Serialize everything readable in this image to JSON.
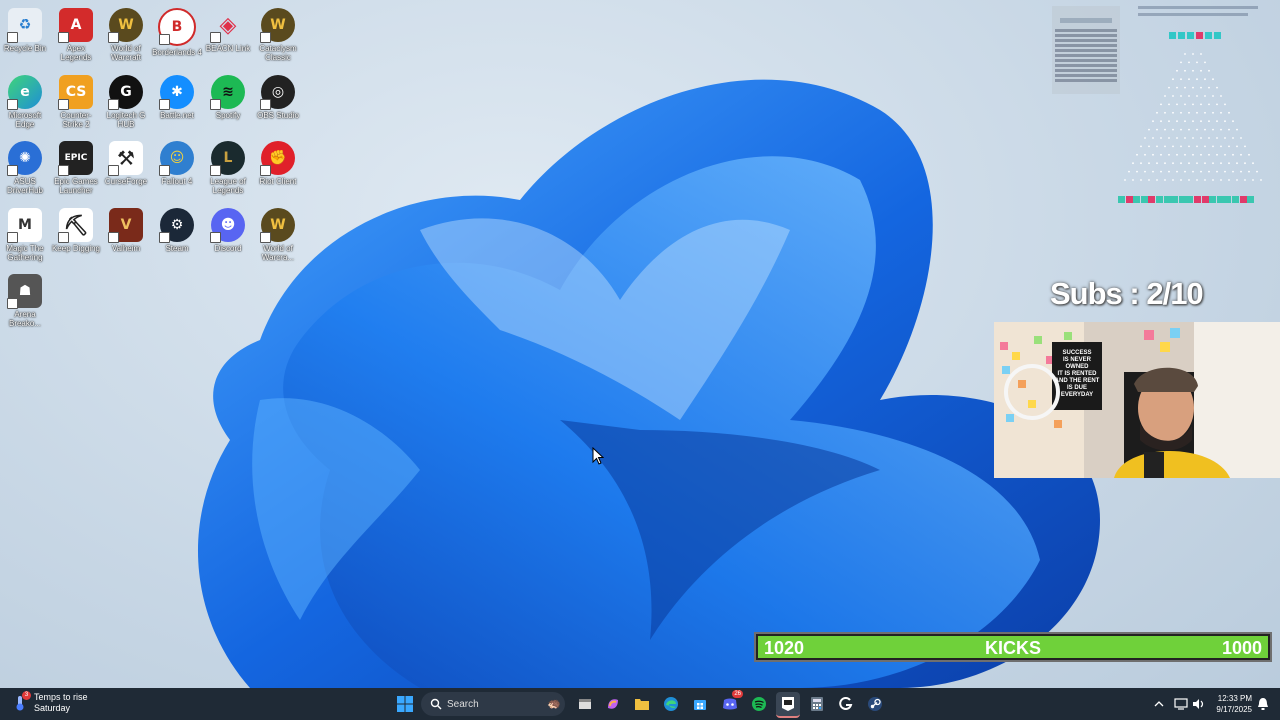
{
  "desktop_icons": [
    {
      "label": "Recycle Bin",
      "icon": "recycle-bin-icon",
      "color": "#ffffff"
    },
    {
      "label": "Apex Legends",
      "icon": "apex-legends-icon",
      "color": "#d32b2b"
    },
    {
      "label": "World of Warcraft",
      "icon": "world-of-warcraft-icon",
      "color": "#5a4a1e"
    },
    {
      "label": "Borderlands 4",
      "icon": "borderlands-icon",
      "color": "#ffffff"
    },
    {
      "label": "BEACN Link",
      "icon": "beacn-icon",
      "color": "#ffffff"
    },
    {
      "label": "Cataclysm Classic",
      "icon": "cataclysm-icon",
      "color": "#5a4a1e"
    },
    {
      "label": "Microsoft Edge",
      "icon": "edge-icon",
      "color": "#1f8fd6"
    },
    {
      "label": "Counter-Strike 2",
      "icon": "counter-strike-icon",
      "color": "#f0a020"
    },
    {
      "label": "Logitech G HUB",
      "icon": "logitech-icon",
      "color": "#111111"
    },
    {
      "label": "Battle.net",
      "icon": "battlenet-icon",
      "color": "#148eff"
    },
    {
      "label": "Spotify",
      "icon": "spotify-icon",
      "color": "#1db954"
    },
    {
      "label": "OBS Studio",
      "icon": "obs-icon",
      "color": "#222222"
    },
    {
      "label": "ASUS DriverHub",
      "icon": "asus-icon",
      "color": "#2a6fd6"
    },
    {
      "label": "Epic Games Launcher",
      "icon": "epic-games-icon",
      "color": "#222222"
    },
    {
      "label": "CurseForge",
      "icon": "curseforge-icon",
      "color": "#ffffff"
    },
    {
      "label": "Fallout 4",
      "icon": "fallout-icon",
      "color": "#2f7fd0"
    },
    {
      "label": "League of Legends",
      "icon": "league-icon",
      "color": "#1a2a2e"
    },
    {
      "label": "Riot Client",
      "icon": "riot-icon",
      "color": "#e0202a"
    },
    {
      "label": "Magic The Gathering",
      "icon": "magic-icon",
      "color": "#ffffff"
    },
    {
      "label": "Keep Digging",
      "icon": "pickaxe-icon",
      "color": "#ffffff"
    },
    {
      "label": "Valheim",
      "icon": "valheim-icon",
      "color": "#7a2a1a"
    },
    {
      "label": "Steam",
      "icon": "steam-icon",
      "color": "#1b2838"
    },
    {
      "label": "Discord",
      "icon": "discord-icon",
      "color": "#5865f2"
    },
    {
      "label": "World of Warcra...",
      "icon": "world-of-warcraft-icon",
      "color": "#5a4a1e"
    },
    {
      "label": "Arena Breako...",
      "icon": "arena-breakout-icon",
      "color": "#555555"
    }
  ],
  "overlay": {
    "subs_text": "Subs : 2/10",
    "kicks": {
      "left": "1020",
      "label": "KICKS",
      "right": "1000",
      "fill_percent": 100
    },
    "poster_lines": [
      "SUCCESS",
      "IS NEVER",
      "OWNED",
      "IT IS RENTED",
      "AND THE RENT",
      "IS DUE",
      "EVERYDAY"
    ]
  },
  "taskbar": {
    "weather_line1": "Temps to rise",
    "weather_line2": "Saturday",
    "weather_badge": "3",
    "search_placeholder": "Search",
    "time": "12:33 PM",
    "date": "9/17/2025",
    "discord_badge": "26",
    "pinned": [
      "file-explorer-icon",
      "copilot-icon",
      "folder-icon",
      "edge-icon",
      "store-icon",
      "discord-icon",
      "spotify-icon",
      "epic-games-icon",
      "calculator-icon",
      "logitech-icon",
      "steam-icon"
    ]
  },
  "colors": {
    "taskbar": "#1f2a36",
    "kicks_green": "#6fd13a",
    "wallpaper_blue": "#1a6fe0"
  }
}
